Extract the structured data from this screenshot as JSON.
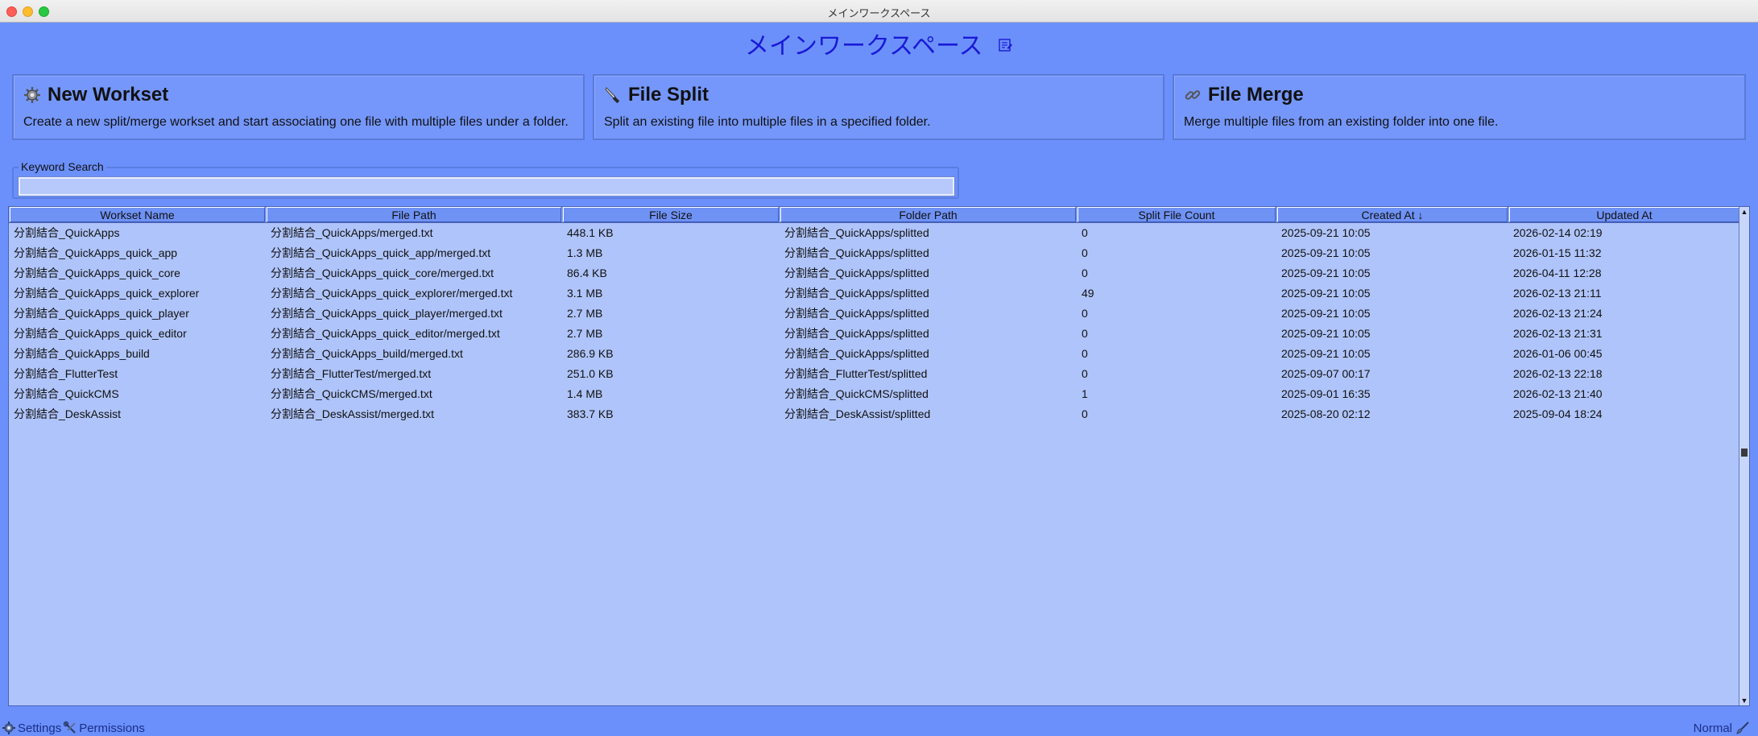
{
  "window": {
    "title": "メインワークスペース"
  },
  "heading": {
    "title": "メインワークスペース",
    "edit_icon": "edit-note-icon"
  },
  "cards": [
    {
      "title": "New Workset",
      "icon": "gear-icon",
      "description": "Create a new split/merge workset and start associating one file with multiple files under a folder."
    },
    {
      "title": "File Split",
      "icon": "knife-icon",
      "description": "Split an existing file into multiple files in a specified folder."
    },
    {
      "title": "File Merge",
      "icon": "link-icon",
      "description": "Merge multiple files from an existing folder into one file."
    }
  ],
  "search": {
    "label": "Keyword Search",
    "value": "",
    "placeholder": ""
  },
  "table": {
    "columns": [
      "Workset Name",
      "File Path",
      "File Size",
      "Folder Path",
      "Split File Count",
      "Created At ↓",
      "Updated At"
    ],
    "rows": [
      [
        "分割結合_QuickApps",
        "分割結合_QuickApps/merged.txt",
        "448.1 KB",
        "分割結合_QuickApps/splitted",
        "0",
        "2025-09-21 10:05",
        "2026-02-14 02:19"
      ],
      [
        "分割結合_QuickApps_quick_app",
        "分割結合_QuickApps_quick_app/merged.txt",
        "1.3 MB",
        "分割結合_QuickApps/splitted",
        "0",
        "2025-09-21 10:05",
        "2026-01-15 11:32"
      ],
      [
        "分割結合_QuickApps_quick_core",
        "分割結合_QuickApps_quick_core/merged.txt",
        "86.4 KB",
        "分割結合_QuickApps/splitted",
        "0",
        "2025-09-21 10:05",
        "2026-04-11 12:28"
      ],
      [
        "分割結合_QuickApps_quick_explorer",
        "分割結合_QuickApps_quick_explorer/merged.txt",
        "3.1 MB",
        "分割結合_QuickApps/splitted",
        "49",
        "2025-09-21 10:05",
        "2026-02-13 21:11"
      ],
      [
        "分割結合_QuickApps_quick_player",
        "分割結合_QuickApps_quick_player/merged.txt",
        "2.7 MB",
        "分割結合_QuickApps/splitted",
        "0",
        "2025-09-21 10:05",
        "2026-02-13 21:24"
      ],
      [
        "分割結合_QuickApps_quick_editor",
        "分割結合_QuickApps_quick_editor/merged.txt",
        "2.7 MB",
        "分割結合_QuickApps/splitted",
        "0",
        "2025-09-21 10:05",
        "2026-02-13 21:31"
      ],
      [
        "分割結合_QuickApps_build",
        "分割結合_QuickApps_build/merged.txt",
        "286.9 KB",
        "分割結合_QuickApps/splitted",
        "0",
        "2025-09-21 10:05",
        "2026-01-06 00:45"
      ],
      [
        "分割結合_FlutterTest",
        "分割結合_FlutterTest/merged.txt",
        "251.0 KB",
        "分割結合_FlutterTest/splitted",
        "0",
        "2025-09-07 00:17",
        "2026-02-13 22:18"
      ],
      [
        "分割結合_QuickCMS",
        "分割結合_QuickCMS/merged.txt",
        "1.4 MB",
        "分割結合_QuickCMS/splitted",
        "1",
        "2025-09-01 16:35",
        "2026-02-13 21:40"
      ],
      [
        "分割結合_DeskAssist",
        "分割結合_DeskAssist/merged.txt",
        "383.7 KB",
        "分割結合_DeskAssist/splitted",
        "0",
        "2025-08-20 02:12",
        "2025-09-04 18:24"
      ]
    ]
  },
  "statusbar": {
    "settings_label": "Settings",
    "permissions_label": "Permissions",
    "mode_label": "Normal",
    "settings_icon": "gear-icon",
    "permissions_icon": "tools-icon",
    "mode_icon": "brush-icon"
  },
  "colors": {
    "background": "#6b90fb",
    "heading": "#1a1ad6",
    "table": "#afc4fa"
  }
}
